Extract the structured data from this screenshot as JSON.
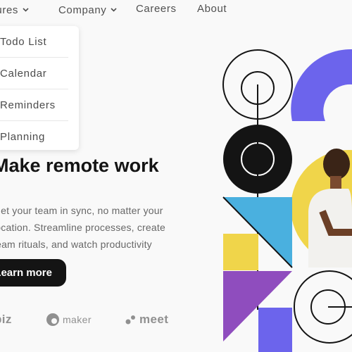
{
  "nav": {
    "features_label": "Features",
    "company_label": "Company",
    "careers_label": "Careers",
    "about_label": "About"
  },
  "dropdown": {
    "items": [
      {
        "label": "Todo List",
        "icon": "todo-icon"
      },
      {
        "label": "Calendar",
        "icon": "calendar-icon"
      },
      {
        "label": "Reminders",
        "icon": "reminders-icon"
      },
      {
        "label": "Planning",
        "icon": "planning-icon"
      }
    ]
  },
  "hero": {
    "headline": "Make remote work",
    "subtext": "Get your team in sync, no matter your location. Streamline processes, create team rituals, and watch productivity soar.",
    "cta_label": "Learn more"
  },
  "clients": [
    {
      "name": "biz",
      "icon": "biz-logo"
    },
    {
      "name": "maker",
      "icon": "maker-logo"
    },
    {
      "name": "meet",
      "icon": "meet-logo"
    }
  ],
  "colors": {
    "purple": "#6c64ec",
    "black": "#141414",
    "sky": "#4ab0df",
    "yellow": "#f0d54a",
    "violet": "#8f4dbe",
    "gray_text": "#676767"
  }
}
